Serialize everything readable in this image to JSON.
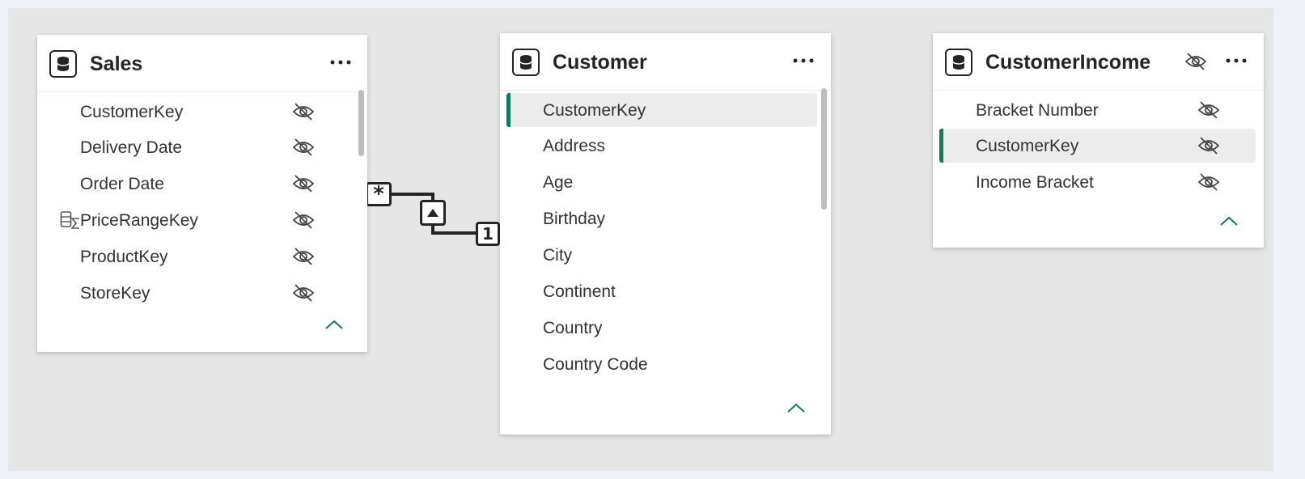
{
  "colors": {
    "accent": "#117865",
    "canvas": "#e6e6e6",
    "card": "#ffffff",
    "text": "#333333",
    "title": "#242424"
  },
  "relationship": {
    "from_cardinality": "*",
    "to_cardinality": "1",
    "cross_filter_icon": "triangle-up-icon"
  },
  "tables": [
    {
      "title": "Sales",
      "icon": "database-icon",
      "more_icon": "more-options-icon",
      "fields": [
        {
          "label": "CustomerKey",
          "hidden": true
        },
        {
          "label": "Delivery Date",
          "hidden": true
        },
        {
          "label": "Order Date",
          "hidden": true
        },
        {
          "label": "PriceRangeKey",
          "hidden": true,
          "icon": "calculated-column-icon"
        },
        {
          "label": "ProductKey",
          "hidden": true
        },
        {
          "label": "StoreKey",
          "hidden": true
        }
      ]
    },
    {
      "title": "Customer",
      "icon": "database-icon",
      "more_icon": "more-options-icon",
      "fields": [
        {
          "label": "CustomerKey",
          "selected": true
        },
        {
          "label": "Address"
        },
        {
          "label": "Age"
        },
        {
          "label": "Birthday"
        },
        {
          "label": "City"
        },
        {
          "label": "Continent"
        },
        {
          "label": "Country"
        },
        {
          "label": "Country Code"
        }
      ]
    },
    {
      "title": "CustomerIncome",
      "icon": "database-icon",
      "more_icon": "more-options-icon",
      "hidden_icon": "eye-off-icon",
      "fields": [
        {
          "label": "Bracket Number",
          "hidden": true
        },
        {
          "label": "CustomerKey",
          "hidden": true,
          "selected": true
        },
        {
          "label": "Income Bracket",
          "hidden": true
        }
      ]
    }
  ]
}
